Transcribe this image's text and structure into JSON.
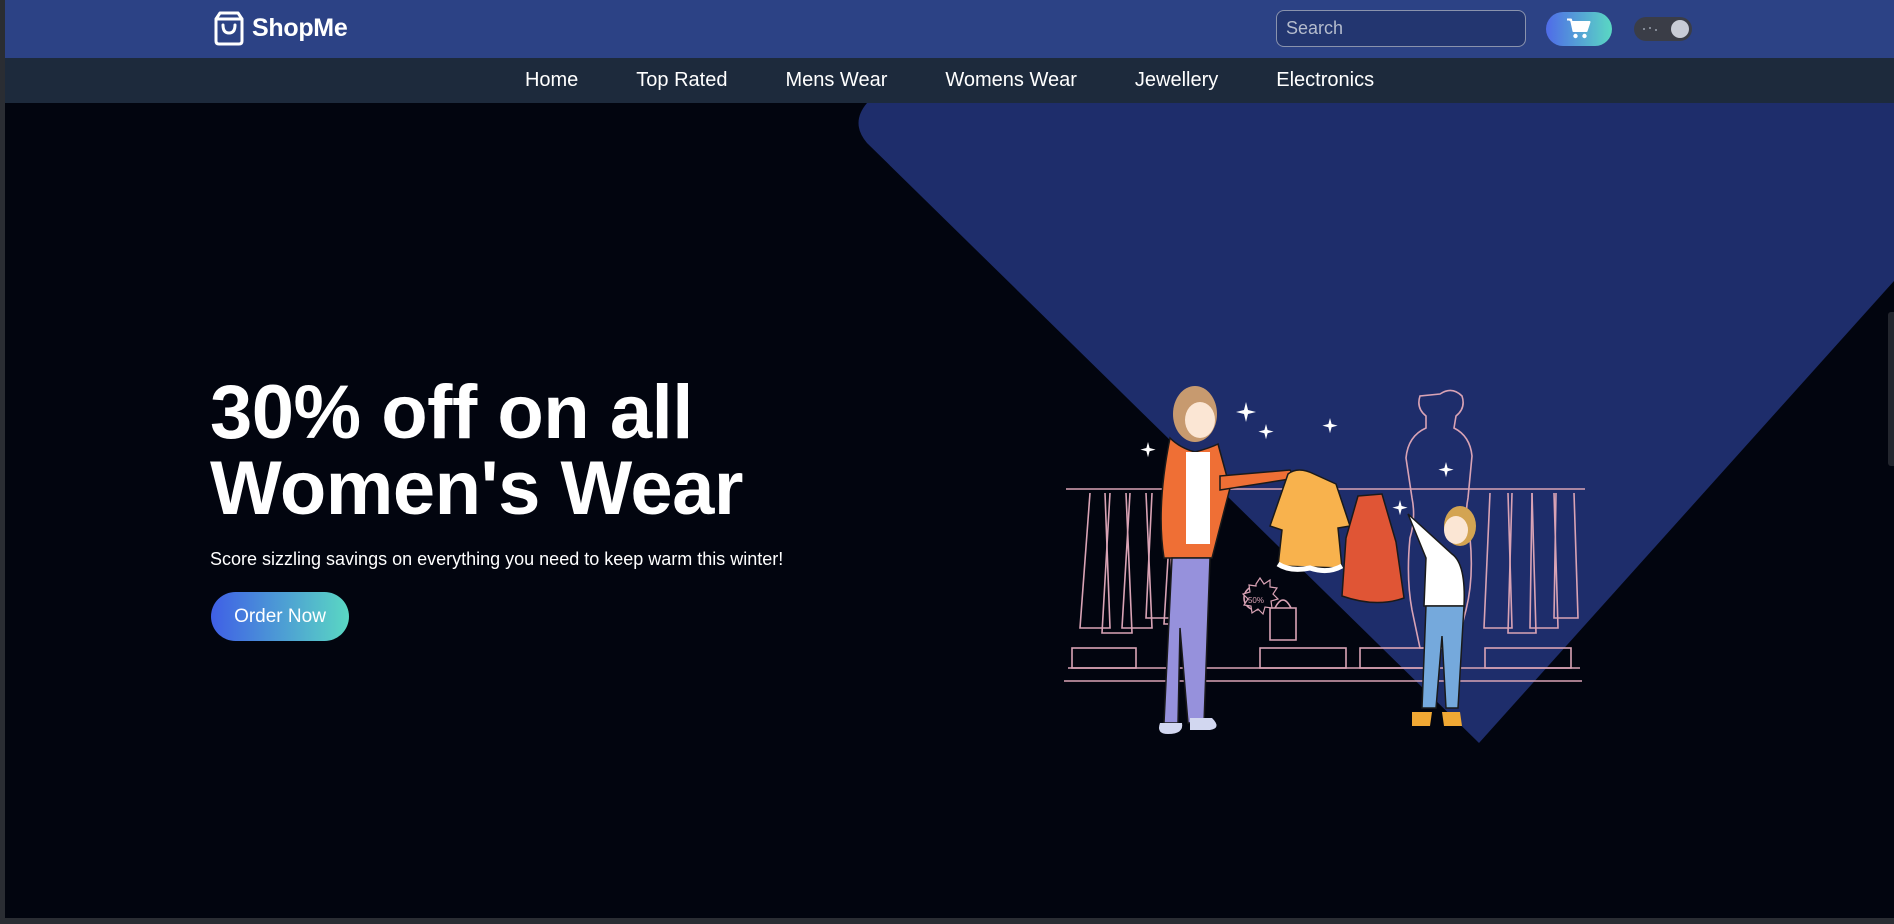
{
  "brand": {
    "name": "ShopMe",
    "icon": "shopping-bag-icon"
  },
  "search": {
    "placeholder": "Search",
    "value": ""
  },
  "cart": {
    "icon": "cart-icon"
  },
  "theme_toggle": {
    "state": "dark"
  },
  "nav": {
    "items": [
      "Home",
      "Top Rated",
      "Mens Wear",
      "Womens Wear",
      "Jewellery",
      "Electronics"
    ]
  },
  "hero": {
    "title_line1": "30% off on all",
    "title_line2": "Women's Wear",
    "subtitle": "Score sizzling savings on everything you need to keep warm this winter!",
    "cta": "Order Now",
    "illustration": "women-shopping-illustration",
    "sale_tag": "50%"
  },
  "colors": {
    "topbar": "#2c4285",
    "navbar": "#1d2a3c",
    "page_bg": "#02050f",
    "hero_accent": "#1e2d6b",
    "button_gradient_start": "#3f5fe6",
    "button_gradient_end": "#5ad8c3"
  }
}
